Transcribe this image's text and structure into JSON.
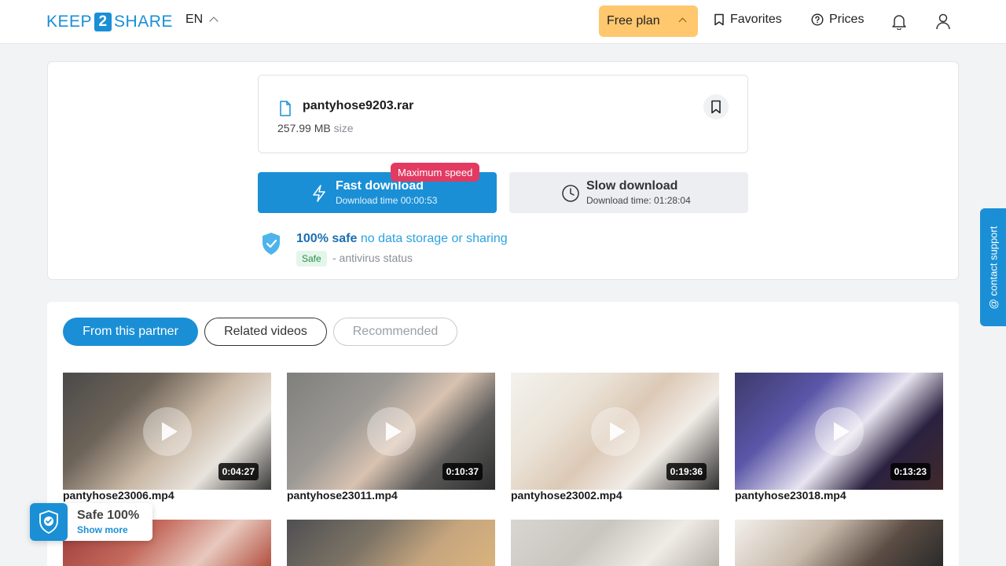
{
  "header": {
    "logo_left": "KEEP",
    "logo_mid": "2",
    "logo_right": "SHARE",
    "language": "EN",
    "plan_label": "Free plan",
    "favorites_label": "Favorites",
    "prices_label": "Prices"
  },
  "file": {
    "name": "pantyhose9203.rar",
    "size_value": "257.99 MB",
    "size_unit": "size"
  },
  "downloads": {
    "fast_title": "Fast download",
    "fast_time": "Download time 00:00:53",
    "fast_badge": "Maximum speed",
    "slow_title": "Slow download",
    "slow_time": "Download time: 01:28:04"
  },
  "safety": {
    "strong": "100% safe",
    "rest": "no data storage or sharing",
    "av_badge": "Safe",
    "av_text": "- antivirus status"
  },
  "tabs": [
    {
      "label": "From this partner",
      "active": true
    },
    {
      "label": "Related videos",
      "active": false
    },
    {
      "label": "Recommended",
      "active": false
    }
  ],
  "videos": [
    {
      "name": "pantyhose23006.mp4",
      "duration": "0:04:27"
    },
    {
      "name": "pantyhose23011.mp4",
      "duration": "0:10:37"
    },
    {
      "name": "pantyhose23002.mp4",
      "duration": "0:19:36"
    },
    {
      "name": "pantyhose23018.mp4",
      "duration": "0:13:23"
    }
  ],
  "support": {
    "label": "@ contact support"
  },
  "safe_widget": {
    "title": "Safe 100%",
    "more": "Show more"
  },
  "colors": {
    "accent": "#1a8fd6",
    "plan": "#ffc76e",
    "badge": "#e33a62"
  }
}
